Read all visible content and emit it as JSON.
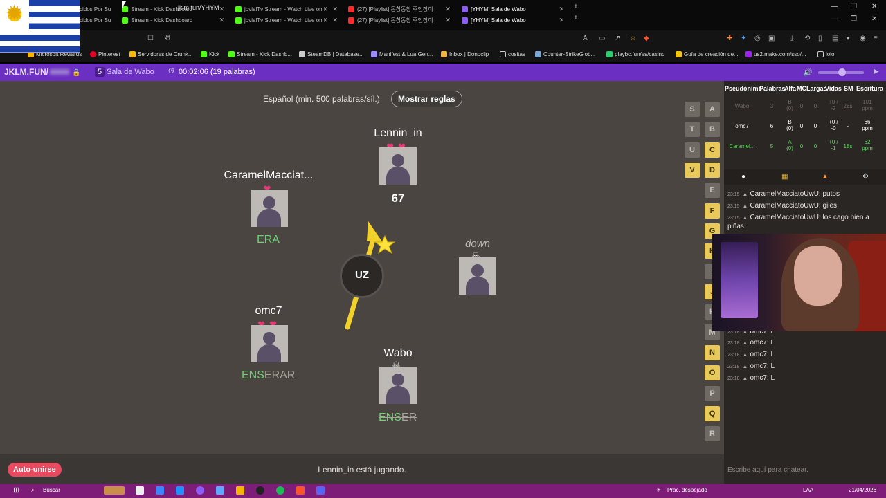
{
  "browser": {
    "tabs": [
      {
        "label": "cidos Por Su",
        "icon": "file-icon"
      },
      {
        "label": "Stream - Kick Dashboard",
        "icon": "kick-icon"
      },
      {
        "label": "jovialTv Stream - Watch Live on K",
        "icon": "kick-icon"
      },
      {
        "label": "(27) [Playlist] 동창동창 주인장이",
        "icon": "youtube-icon"
      },
      {
        "label": "[YHYM] Sala de Wabo",
        "icon": "jklm-icon"
      }
    ],
    "tabs_row2": [
      {
        "label": "cidos Por Su"
      },
      {
        "label": "Stream - Kick Dashboard"
      },
      {
        "label": "jovialTv Stream - Watch Live on K"
      },
      {
        "label": "(27) [Playlist] 동창동창 주인장이"
      },
      {
        "label": "[YHYM] Sala de Wabo"
      }
    ],
    "url": "jklm.fun/YHYM",
    "bookmarks": [
      "Microsoft Rewards",
      "Pinterest",
      "Servidores de Drunk...",
      "Kick",
      "Stream - Kick Dashb...",
      "SteamDB | Database...",
      "Manifest & Lua Gen...",
      "Inbox | Donoclip",
      "cositas",
      "Counter-StrikeGlob...",
      "playbc.fun/es/casino",
      "Guía de creación de...",
      "us2.make.com/sso/...",
      "lolo"
    ]
  },
  "game_header": {
    "site": "JKLM.FUN/",
    "room_count": "5",
    "room_name": "Sala de Wabo",
    "timer": "00:02:06 (19 palabras)"
  },
  "game": {
    "language": "Español (min. 500 palabras/síl.)",
    "rules_button": "Mostrar reglas",
    "syllable": "UZ",
    "score": "67",
    "status": "Lennin_in está jugando.",
    "auto_join": "Auto-unirse",
    "players": [
      {
        "name": "Lennin_in",
        "hearts": "❤❤",
        "word_ok": "",
        "word_rest": ""
      },
      {
        "name": "CaramelMacciat...",
        "hearts": "❤",
        "word_ok": "ERA",
        "word_rest": ""
      },
      {
        "name": "down",
        "hearts": "",
        "word_ok": "",
        "word_rest": ""
      },
      {
        "name": "omc7",
        "hearts": "❤❤",
        "word_ok": "ENS",
        "word_rest": "ERAR"
      },
      {
        "name": "Wabo",
        "hearts": "",
        "word_ok": "ENS",
        "word_rest": "ER"
      }
    ],
    "letters_left": [
      "S",
      "T",
      "U",
      "V"
    ],
    "letters_right": [
      "A",
      "B",
      "C",
      "D",
      "E",
      "F",
      "G",
      "H",
      "I",
      "J",
      "K",
      "L",
      "M",
      "N",
      "O",
      "P",
      "Q",
      "R"
    ]
  },
  "scoreboard": {
    "headers": [
      "Pseudónimo",
      "Palabras",
      "Alfa",
      "MC",
      "Largas",
      "Vidas",
      "SM",
      "Escritura"
    ],
    "rows": [
      {
        "name": "Wabo",
        "words": "3",
        "alpha": "B (0)",
        "mc": "0",
        "long": "0",
        "lives": "+0 / -2",
        "sm": "28s",
        "speed": "101 ppm"
      },
      {
        "name": "omc7",
        "words": "6",
        "alpha": "B (0)",
        "mc": "0",
        "long": "0",
        "lives": "+0 / -0",
        "sm": "-",
        "speed": "66 ppm"
      },
      {
        "name": "Caramel...",
        "words": "5",
        "alpha": "A (0)",
        "mc": "0",
        "long": "0",
        "lives": "+0 / -1",
        "sm": "18s",
        "speed": "62 ppm"
      }
    ],
    "colors": {
      "gold": "#f0c040",
      "green": "#5fd35f"
    }
  },
  "chat": {
    "messages": [
      {
        "time": "23:15",
        "user": "CaramelMacciatoUwU",
        "text": "putos"
      },
      {
        "time": "23:15",
        "user": "CaramelMacciatoUwU",
        "text": "giles"
      },
      {
        "time": "23:15",
        "user": "CaramelMacciatoUwU",
        "text": "los cago bien a piñas"
      },
      {
        "time": "23:18",
        "user": "omc7",
        "text": "L"
      },
      {
        "time": "23:18",
        "user": "omc7",
        "text": "L"
      },
      {
        "time": "23:18",
        "user": "omc7",
        "text": "L"
      },
      {
        "time": "23:18",
        "user": "omc7",
        "text": "L"
      },
      {
        "time": "23:18",
        "user": "omc7",
        "text": "L"
      }
    ],
    "placeholder": "Escribe aquí para chatear."
  },
  "taskbar": {
    "search": "Buscar",
    "weather": "Prac. despejado",
    "lang": "LAA",
    "date": "21/04/2026"
  },
  "colors": {
    "purple": "#6b2fc2",
    "taskbar": "#7e1d78",
    "heart": "#e83a7a",
    "word_ok": "#6ad36f"
  }
}
